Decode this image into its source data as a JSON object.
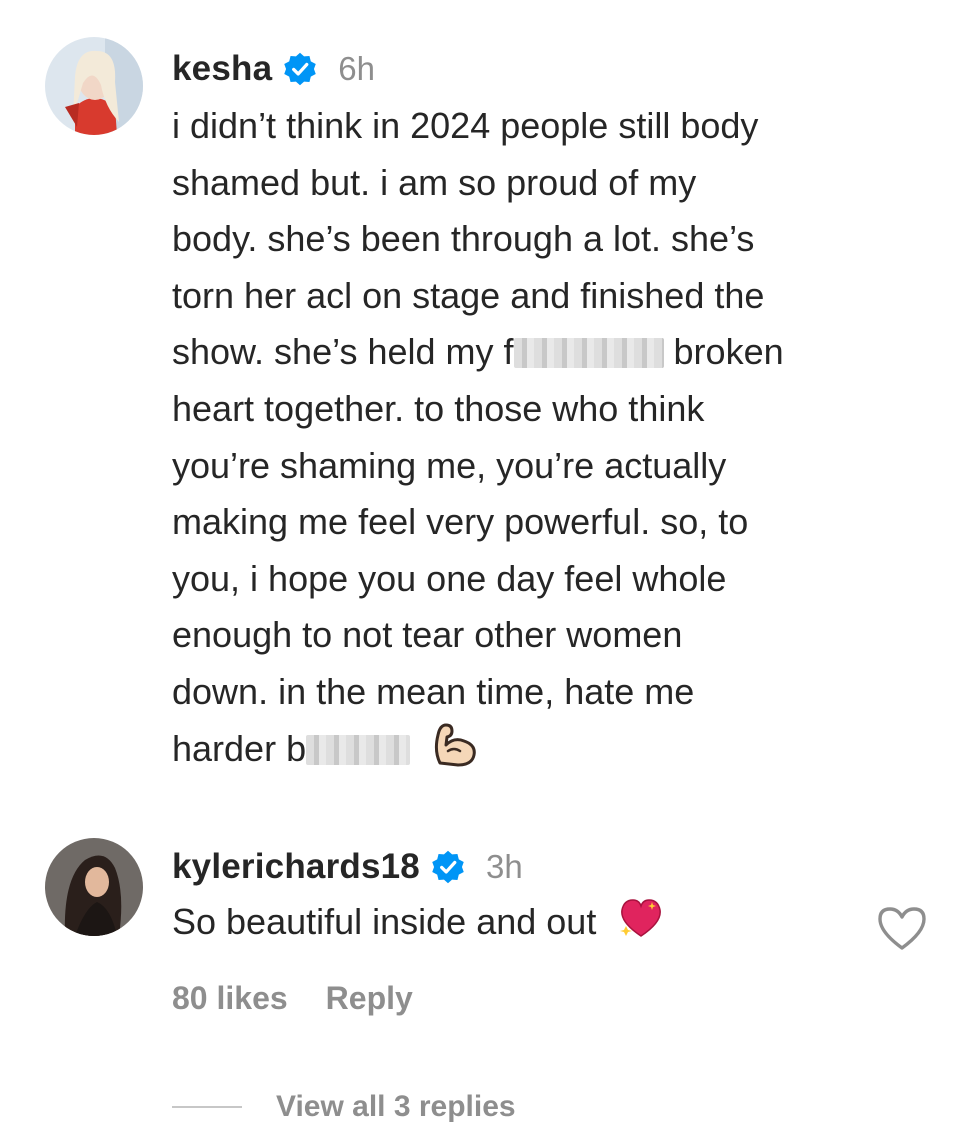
{
  "comments": [
    {
      "username": "kesha",
      "time": "6h",
      "lines": [
        "i didn’t think in 2024 people still body",
        "shamed but. i am so proud of my",
        "body. she’s been through a lot. she’s",
        "torn her acl on stage and finished the",
        "show. she’s held my f",
        "broken",
        "heart together. to those who think",
        "you’re shaming me, you’re actually",
        "making me feel very powerful. so, to",
        "you, i hope you one day feel whole",
        "enough to not tear other women",
        "down. in the mean time, hate me",
        "harder b"
      ],
      "emoji": "flexed-biceps-emoji"
    },
    {
      "username": "kylerichards18",
      "time": "3h",
      "text": "So beautiful inside and out",
      "emoji": "sparkling-heart-emoji",
      "likes": "80 likes",
      "reply_label": "Reply"
    }
  ],
  "view_replies": "View all 3 replies",
  "colors": {
    "text": "#262626",
    "muted": "#8e8e8e",
    "verified": "#0095f6"
  },
  "icons": [
    "verified-badge-icon",
    "heart-outline-icon"
  ]
}
